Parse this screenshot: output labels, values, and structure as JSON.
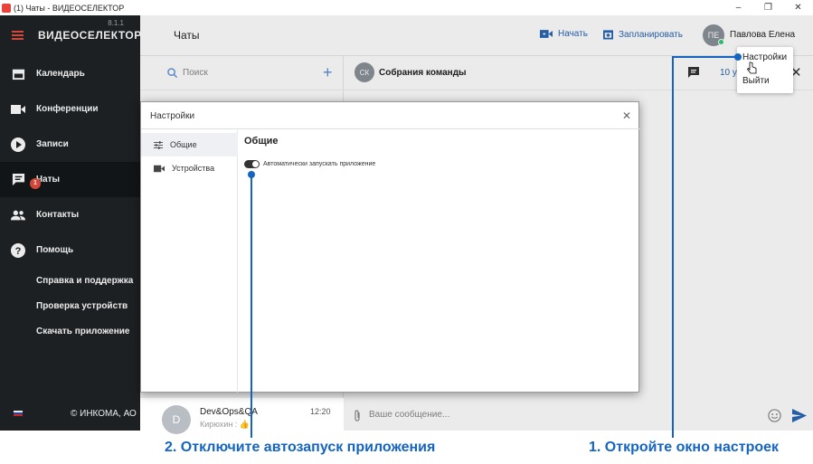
{
  "window": {
    "title": "(1) Чаты - ВИДЕОСЕЛЕКТОР",
    "minimize": "–",
    "restore": "❐",
    "close": "✕"
  },
  "sidebar": {
    "brand": "ВИДЕОСЕЛЕКТОР",
    "version": "8.1.1",
    "items": [
      {
        "label": "Календарь",
        "icon": "calendar-icon"
      },
      {
        "label": "Конференции",
        "icon": "video-icon"
      },
      {
        "label": "Записи",
        "icon": "play-icon"
      },
      {
        "label": "Чаты",
        "icon": "chat-icon",
        "badge": "1",
        "active": true
      },
      {
        "label": "Контакты",
        "icon": "contacts-icon"
      },
      {
        "label": "Помощь",
        "icon": "help-icon"
      }
    ],
    "sub_items": [
      "Справка и поддержка",
      "Проверка устройств",
      "Скачать приложение"
    ],
    "copyright": "© ИНКОМА, АО",
    "accent": "#e74c3c"
  },
  "topbar": {
    "page_title": "Чаты",
    "start_label": "Начать",
    "schedule_label": "Запланировать",
    "user_initials": "ПЕ",
    "user_name": "Павлова Елена",
    "link_color": "#2a66b5"
  },
  "chatlist": {
    "search_placeholder": "Поиск",
    "bottom_item": {
      "initial": "D",
      "name": "Dev&Ops&QA",
      "time": "12:20",
      "preview": "Кирюхин : 👍"
    }
  },
  "chatpane": {
    "initials": "СК",
    "title": "Собрания команды",
    "participants": "10 у",
    "message_placeholder": "Ваше сообщение..."
  },
  "dropdown": {
    "settings": "Настройки",
    "logout": "Выйти"
  },
  "settings_modal": {
    "title": "Настройки",
    "tabs": [
      {
        "label": "Общие",
        "active": true
      },
      {
        "label": "Устройства",
        "active": false
      }
    ],
    "section_title": "Общие",
    "autostart_label": "Автоматически запускать приложение",
    "autostart_on": true
  },
  "annotations": {
    "step1": "1. Откройте окно настроек",
    "step2": "2. Отключите автозапуск приложения",
    "color": "#1565c0"
  }
}
